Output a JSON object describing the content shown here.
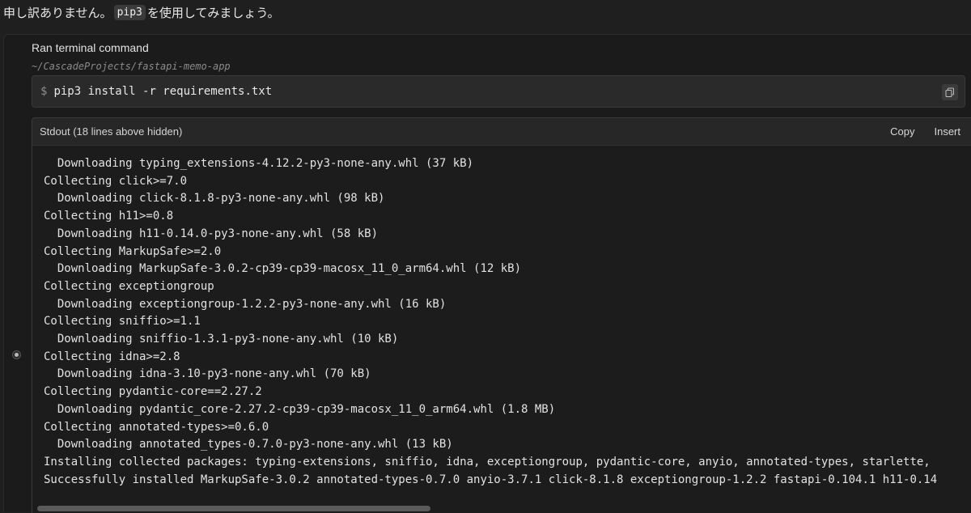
{
  "intro": {
    "before": "申し訳ありません。",
    "code": "pip3",
    "after": "を使用してみましょう。"
  },
  "panel": {
    "title": "Ran terminal command",
    "cwd": "~/CascadeProjects/fastapi-memo-app",
    "prompt_symbol": "$",
    "command": "pip3 install -r requirements.txt"
  },
  "stdout": {
    "header": "Stdout (18 lines above hidden)",
    "copy_label": "Copy",
    "insert_label": "Insert",
    "lines": [
      "  Downloading typing_extensions-4.12.2-py3-none-any.whl (37 kB)",
      "Collecting click>=7.0",
      "  Downloading click-8.1.8-py3-none-any.whl (98 kB)",
      "Collecting h11>=0.8",
      "  Downloading h11-0.14.0-py3-none-any.whl (58 kB)",
      "Collecting MarkupSafe>=2.0",
      "  Downloading MarkupSafe-3.0.2-cp39-cp39-macosx_11_0_arm64.whl (12 kB)",
      "Collecting exceptiongroup",
      "  Downloading exceptiongroup-1.2.2-py3-none-any.whl (16 kB)",
      "Collecting sniffio>=1.1",
      "  Downloading sniffio-1.3.1-py3-none-any.whl (10 kB)",
      "Collecting idna>=2.8",
      "  Downloading idna-3.10-py3-none-any.whl (70 kB)",
      "Collecting pydantic-core==2.27.2",
      "  Downloading pydantic_core-2.27.2-cp39-cp39-macosx_11_0_arm64.whl (1.8 MB)",
      "Collecting annotated-types>=0.6.0",
      "  Downloading annotated_types-0.7.0-py3-none-any.whl (13 kB)",
      "Installing collected packages: typing-extensions, sniffio, idna, exceptiongroup, pydantic-core, anyio, annotated-types, starlette,",
      "Successfully installed MarkupSafe-3.0.2 annotated-types-0.7.0 anyio-3.7.1 click-8.1.8 exceptiongroup-1.2.2 fastapi-0.104.1 h11-0.14"
    ]
  },
  "icons": {
    "copy": "copy-icon",
    "status": "radio-indicator-icon"
  }
}
